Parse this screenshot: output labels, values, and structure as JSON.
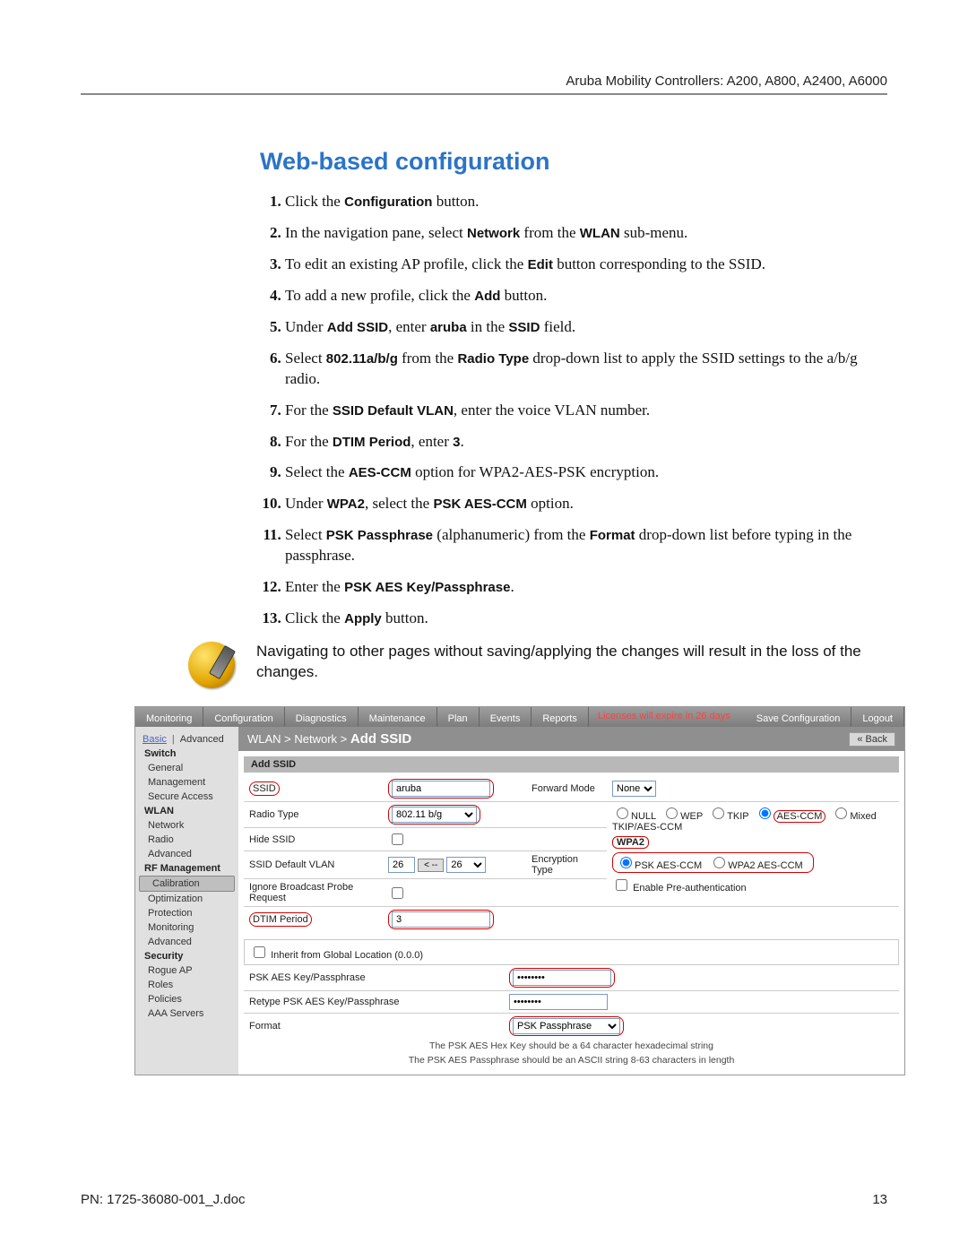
{
  "running_head": "Aruba Mobility Controllers: A200, A800, A2400, A6000",
  "section_title": "Web-based configuration",
  "steps": [
    "Click the <b>Configuration</b> button.",
    "In the navigation pane, select <b>Network</b> from the <b>WLAN</b> sub-menu.",
    "To edit an existing AP profile, click the <b>Edit</b> button corresponding to the SSID.",
    "To add a new profile, click the <b>Add</b> button.",
    "Under <b>Add SSID</b>, enter <b>aruba</b> in the <b>SSID</b> field.",
    "Select <b>802.11a/b/g</b> from the <b>Radio Type</b> drop-down list to apply the SSID settings to the a/b/g radio.",
    "For the <b>SSID Default VLAN</b>, enter the voice VLAN number.",
    "For the <b>DTIM Period</b>, enter <b>3</b>.",
    "Select the <b>AES-CCM</b> option for WPA2-AES-PSK encryption.",
    "Under <b>WPA2</b>, select the <b>PSK AES-CCM</b> option.",
    "Select <b>PSK Passphrase</b> (alphanumeric) from the <b>Format</b> drop-down list before typing in the passphrase.",
    "Enter the <b>PSK AES Key/Passphrase</b>.",
    "Click the <b>Apply</b> button."
  ],
  "note": "Navigating to other pages without saving/applying the changes will result in the loss of the changes.",
  "shot": {
    "tabs": [
      "Monitoring",
      "Configuration",
      "Diagnostics",
      "Maintenance",
      "Plan",
      "Events",
      "Reports"
    ],
    "license_warn": "Licenses will expire in 26 days",
    "right_tabs": [
      "Save Configuration",
      "Logout"
    ],
    "nav_top": [
      "Basic",
      "Advanced"
    ],
    "nav": [
      {
        "t": "Switch",
        "head": true
      },
      {
        "t": "General"
      },
      {
        "t": "Management"
      },
      {
        "t": "Secure Access"
      },
      {
        "t": "WLAN",
        "head": true
      },
      {
        "t": "Network"
      },
      {
        "t": "Radio"
      },
      {
        "t": "Advanced"
      },
      {
        "t": "RF Management",
        "head": true
      },
      {
        "t": "Calibration",
        "sel": true
      },
      {
        "t": "Optimization"
      },
      {
        "t": "Protection"
      },
      {
        "t": "Monitoring"
      },
      {
        "t": "Advanced"
      },
      {
        "t": "Security",
        "head": true
      },
      {
        "t": "Rogue AP"
      },
      {
        "t": "Roles"
      },
      {
        "t": "Policies"
      },
      {
        "t": "AAA Servers"
      }
    ],
    "breadcrumb_pre": "WLAN > Network > ",
    "breadcrumb_bold": "Add SSID",
    "back_btn": "« Back",
    "panel_head": "Add SSID",
    "fields": {
      "ssid_label": "SSID",
      "ssid_value": "aruba",
      "forward_label": "Forward Mode",
      "forward_value": "None",
      "radio_label": "Radio Type",
      "radio_value": "802.11 b/g",
      "hide_label": "Hide SSID",
      "vlan_label": "SSID Default VLAN",
      "vlan_a": "26",
      "vlan_mid": "< --",
      "vlan_b": "26",
      "enc_label": "Encryption Type",
      "enc_opts": [
        "NULL",
        "WEP",
        "TKIP",
        "AES-CCM",
        "Mixed TKIP/AES-CCM"
      ],
      "enc_sel": "AES-CCM",
      "wpa2_label": "WPA2",
      "wpa2_opts": [
        "PSK AES-CCM",
        "WPA2 AES-CCM"
      ],
      "wpa2_sel": "PSK AES-CCM",
      "preauth_label": "Enable Pre-authentication",
      "ignore_label": "Ignore Broadcast Probe Request",
      "dtim_label": "DTIM Period",
      "dtim_value": "3",
      "inherit_label": "Inherit from Global Location (0.0.0)",
      "psk_label": "PSK AES Key/Passphrase",
      "psk_value": "********",
      "retype_label": "Retype PSK AES Key/Passphrase",
      "retype_value": "********",
      "format_label": "Format",
      "format_value": "PSK Passphrase",
      "hint1": "The PSK AES Hex Key should be a 64 character hexadecimal string",
      "hint2": "The PSK AES Passphrase should be an ASCII string 8-63 characters in length"
    }
  },
  "footer_left": "PN: 1725-36080-001_J.doc",
  "footer_right": "13"
}
